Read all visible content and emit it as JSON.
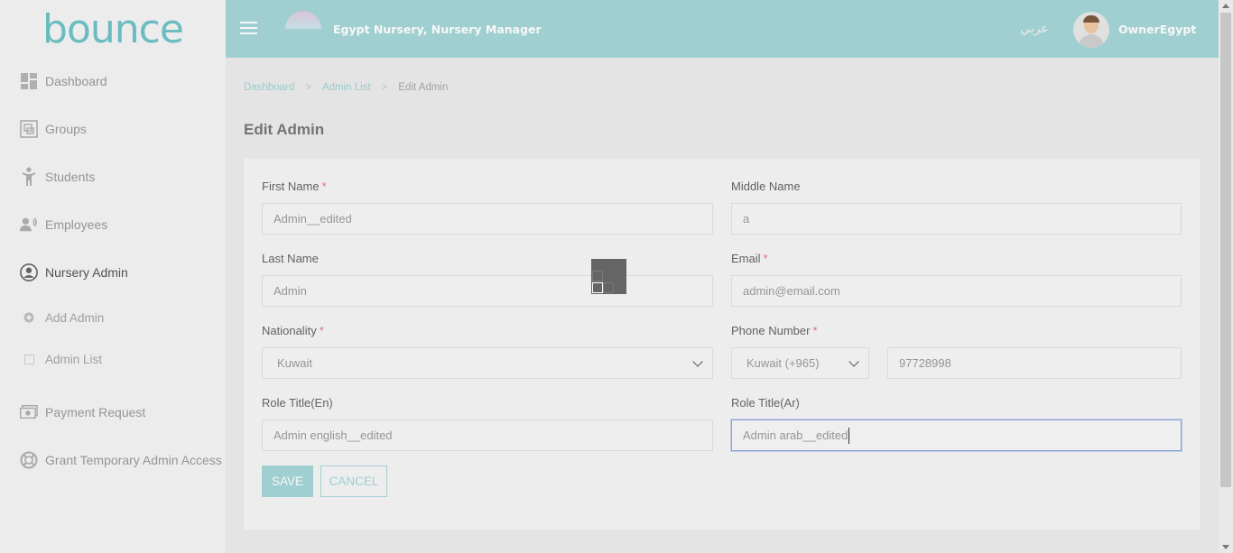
{
  "brand": {
    "logo_text": "bounce",
    "accent": "#a6d6d8",
    "logo_color": "#6fc3c7"
  },
  "header": {
    "title": "Egypt Nursery, Nursery Manager",
    "language_toggle": "عربي",
    "username": "OwnerEgypt",
    "menu_icon": "hamburger-icon"
  },
  "sidebar": {
    "items": [
      {
        "label": "Dashboard",
        "icon": "dashboard-icon"
      },
      {
        "label": "Groups",
        "icon": "groups-icon"
      },
      {
        "label": "Students",
        "icon": "student-icon"
      },
      {
        "label": "Employees",
        "icon": "employees-icon"
      },
      {
        "label": "Nursery Admin",
        "icon": "user-circle-icon",
        "active": true
      },
      {
        "label": "Add Admin",
        "icon": "plus-circle-icon",
        "sub": true
      },
      {
        "label": "Admin List",
        "icon": "square-icon",
        "sub": true
      },
      {
        "label": "Payment Request",
        "icon": "money-icon"
      },
      {
        "label": "Grant Temporary Admin Access",
        "icon": "lifebuoy-icon"
      }
    ]
  },
  "breadcrumb": {
    "items": [
      "Dashboard",
      "Admin List"
    ],
    "separator": ">",
    "current": "Edit Admin"
  },
  "page": {
    "title": "Edit Admin"
  },
  "form": {
    "first_name": {
      "label": "First Name",
      "required": "*",
      "value": "Admin__edited"
    },
    "middle_name": {
      "label": "Middle Name",
      "value": "a"
    },
    "last_name": {
      "label": "Last Name",
      "value": "Admin"
    },
    "email": {
      "label": "Email",
      "required": "*",
      "value": "admin@email.com"
    },
    "nationality": {
      "label": "Nationality",
      "required": "*",
      "value": "Kuwait"
    },
    "phone": {
      "label": "Phone Number",
      "required": "*",
      "country": "Kuwait (+965)",
      "value": "97728998"
    },
    "role_title_en": {
      "label": "Role Title(En)",
      "value": "Admin english__edited"
    },
    "role_title_ar": {
      "label": "Role Title(Ar)",
      "value": "Admin arab__edited"
    }
  },
  "actions": {
    "save": "SAVE",
    "cancel": "CANCEL"
  }
}
